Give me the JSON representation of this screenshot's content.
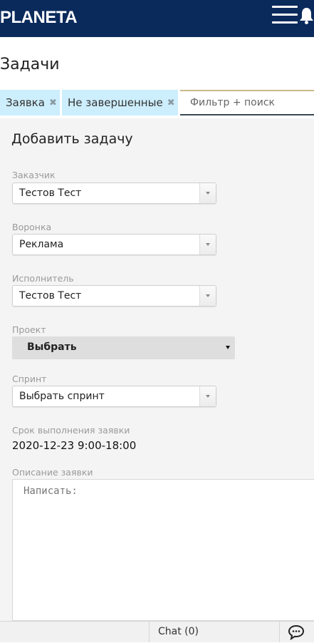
{
  "app": {
    "brand": "PLANETA"
  },
  "page": {
    "title": "Задачи"
  },
  "filters": {
    "chips": [
      {
        "label": "Заявка"
      },
      {
        "label": "Не завершенные"
      }
    ],
    "remove_symbol": "✖",
    "search_placeholder": "Фильтр + поиск"
  },
  "form": {
    "title": "Добавить задачу",
    "customer": {
      "label": "Заказчик",
      "value": "Тестов Тест"
    },
    "funnel": {
      "label": "Воронка",
      "value": "Реклама"
    },
    "assignee": {
      "label": "Исполнитель",
      "value": "Тестов Тест"
    },
    "project": {
      "label": "Проект",
      "value": "Выбрать"
    },
    "sprint": {
      "label": "Спринт",
      "value": "Выбрать спринт"
    },
    "deadline": {
      "label": "Срок выполнения заявки",
      "value": "2020-12-23 9:00-18:00"
    },
    "description": {
      "label": "Описание заявки",
      "placeholder": "Написать:"
    }
  },
  "chat": {
    "label": "Chat (0)"
  },
  "colors": {
    "header": "#0b2a5c",
    "chip_bg": "#cdeefc",
    "panel_bg": "#f4f4f4"
  }
}
